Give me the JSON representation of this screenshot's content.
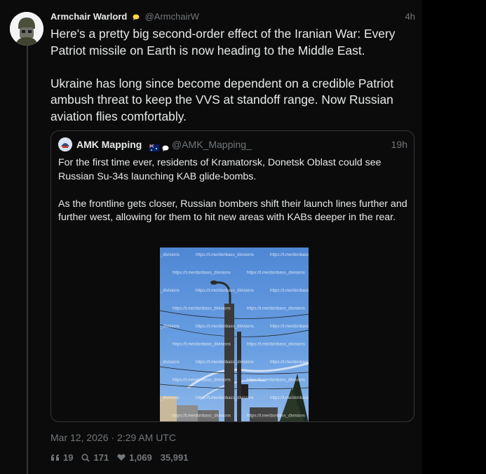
{
  "tweet": {
    "author_name": "Armchair Warlord",
    "author_handle": "@ArmchairW",
    "time_ago": "4h",
    "text": "Here's a pretty big second-order effect of the Iranian War: Every Patriot missile on Earth is now heading to the Middle East.\n\nUkraine has long since become dependent on a credible Patriot ambush threat to keep the VVS at standoff range.  Now Russian aviation flies comfortably.",
    "timestamp": "Mar 12, 2026 · 2:29 AM UTC",
    "stats": {
      "quotes": "19",
      "replies": "171",
      "likes": "1,069",
      "views": "35,991"
    }
  },
  "quoted": {
    "author_name": "AMK Mapping",
    "author_handle": "@AMK_Mapping_",
    "time_ago": "19h",
    "text": "For the first time ever, residents of Kramatorsk, Donetsk Oblast could see Russian Su-34s launching KAB glide-bombs.\n\nAs the frontline gets closer, Russian bombers shift their launch lines further and further west, allowing for them to hit new areas with KABs deeper in the rear.",
    "image_watermark": "https://t.me/donbass_divisions"
  },
  "colors": {
    "background": "#000000",
    "text": "#e7e9ea",
    "muted": "#71767b",
    "border": "#333639",
    "sky": "#5f95de"
  }
}
